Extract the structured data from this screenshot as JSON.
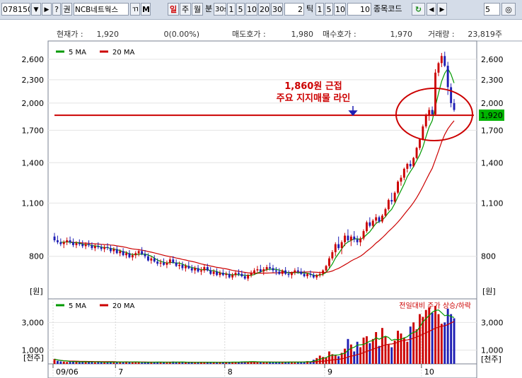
{
  "toolbar": {
    "stock_code": "078150",
    "btn_dropdown": "▼",
    "btn_next": "▶",
    "btn_help": "?",
    "btn_right": "권",
    "stock_name": "NCB네트웍스",
    "btn_mode1": "ㄲ",
    "btn_mode2": "M",
    "period_day": "일",
    "period_week": "주",
    "period_month": "월",
    "minute_label": "분",
    "minute_options": [
      "30s",
      "1",
      "5",
      "10",
      "20",
      "30"
    ],
    "minute_input": "2",
    "tick_label": "틱",
    "tick_options": [
      "1",
      "5",
      "10"
    ],
    "tick_input": "10",
    "code_label": "종목코드",
    "count_input": "5"
  },
  "info_bar": {
    "price_label": "현재가 :",
    "price_value": "1,920",
    "change_value": "0(0.00%)",
    "ask_label": "매도호가 :",
    "ask_value": "1,980",
    "bid_label": "매수호가 :",
    "bid_value": "1,970",
    "volume_label": "거래량 :",
    "volume_value": "23,819주"
  },
  "price_panel": {
    "legend": [
      "5 MA",
      "20 MA"
    ],
    "unit_label": "[원]",
    "current_price_tag": "1,920",
    "annotation_line1": "1,860원 근접",
    "annotation_line2": "주요 지지매물 라인"
  },
  "volume_panel": {
    "legend": [
      "5 MA",
      "20 MA"
    ],
    "unit_label": "[천주]",
    "right_note": "전일대비 주가 상승/하락"
  },
  "x_labels": [
    "09/06",
    "7",
    "8",
    "9",
    "10"
  ],
  "colors": {
    "up": "#cc0000",
    "down": "#1e1eb4",
    "ma5": "#009900",
    "ma20": "#cc0000",
    "support_line": "#cc0000",
    "price_tag": "#00b400"
  },
  "chart_data": [
    {
      "type": "candlestick",
      "title": "",
      "y_scale": "log",
      "y_ticks": [
        800,
        1100,
        1400,
        1700,
        2000,
        2300,
        2600
      ],
      "ylim": [
        620,
        2900
      ],
      "support_level": 1860,
      "series": [
        {
          "name": "5 MA"
        },
        {
          "name": "20 MA"
        }
      ],
      "candles": [
        [
          900,
          920,
          870,
          880
        ],
        [
          880,
          905,
          860,
          870
        ],
        [
          870,
          890,
          850,
          860
        ],
        [
          860,
          880,
          840,
          870
        ],
        [
          870,
          895,
          855,
          880
        ],
        [
          880,
          900,
          860,
          870
        ],
        [
          870,
          890,
          845,
          855
        ],
        [
          855,
          875,
          840,
          865
        ],
        [
          865,
          885,
          850,
          860
        ],
        [
          860,
          880,
          840,
          850
        ],
        [
          850,
          870,
          835,
          860
        ],
        [
          860,
          880,
          845,
          855
        ],
        [
          855,
          870,
          830,
          840
        ],
        [
          840,
          860,
          825,
          850
        ],
        [
          850,
          870,
          835,
          845
        ],
        [
          845,
          860,
          825,
          835
        ],
        [
          835,
          855,
          820,
          845
        ],
        [
          845,
          865,
          830,
          840
        ],
        [
          840,
          855,
          815,
          825
        ],
        [
          825,
          845,
          810,
          835
        ],
        [
          835,
          850,
          810,
          815
        ],
        [
          815,
          835,
          800,
          825
        ],
        [
          825,
          840,
          800,
          805
        ],
        [
          805,
          825,
          790,
          815
        ],
        [
          815,
          830,
          790,
          795
        ],
        [
          795,
          815,
          780,
          805
        ],
        [
          805,
          825,
          790,
          815
        ],
        [
          815,
          835,
          800,
          825
        ],
        [
          825,
          845,
          805,
          810
        ],
        [
          810,
          830,
          790,
          800
        ],
        [
          800,
          815,
          775,
          780
        ],
        [
          780,
          800,
          765,
          790
        ],
        [
          790,
          805,
          770,
          775
        ],
        [
          775,
          790,
          755,
          765
        ],
        [
          765,
          785,
          750,
          770
        ],
        [
          770,
          790,
          755,
          760
        ],
        [
          760,
          780,
          745,
          770
        ],
        [
          770,
          795,
          760,
          785
        ],
        [
          785,
          800,
          765,
          770
        ],
        [
          770,
          785,
          750,
          755
        ],
        [
          755,
          775,
          740,
          760
        ],
        [
          760,
          775,
          735,
          745
        ],
        [
          745,
          765,
          730,
          755
        ],
        [
          755,
          775,
          740,
          745
        ],
        [
          745,
          760,
          725,
          735
        ],
        [
          735,
          755,
          720,
          745
        ],
        [
          745,
          760,
          725,
          730
        ],
        [
          730,
          750,
          715,
          735
        ],
        [
          735,
          760,
          725,
          750
        ],
        [
          750,
          765,
          730,
          735
        ],
        [
          735,
          750,
          715,
          720
        ],
        [
          720,
          740,
          710,
          730
        ],
        [
          730,
          745,
          710,
          715
        ],
        [
          715,
          735,
          705,
          725
        ],
        [
          725,
          740,
          710,
          715
        ],
        [
          715,
          730,
          700,
          720
        ],
        [
          720,
          735,
          700,
          705
        ],
        [
          705,
          725,
          695,
          715
        ],
        [
          715,
          735,
          705,
          725
        ],
        [
          725,
          740,
          710,
          720
        ],
        [
          720,
          735,
          705,
          710
        ],
        [
          710,
          725,
          695,
          700
        ],
        [
          700,
          720,
          690,
          715
        ],
        [
          715,
          735,
          705,
          725
        ],
        [
          725,
          745,
          715,
          735
        ],
        [
          735,
          755,
          720,
          740
        ],
        [
          740,
          760,
          725,
          730
        ],
        [
          730,
          750,
          715,
          740
        ],
        [
          740,
          760,
          730,
          750
        ],
        [
          750,
          770,
          735,
          745
        ],
        [
          745,
          760,
          725,
          735
        ],
        [
          735,
          750,
          715,
          730
        ],
        [
          730,
          745,
          715,
          720
        ],
        [
          720,
          740,
          710,
          735
        ],
        [
          735,
          750,
          715,
          720
        ],
        [
          720,
          735,
          705,
          715
        ],
        [
          715,
          730,
          700,
          725
        ],
        [
          725,
          745,
          715,
          735
        ],
        [
          735,
          750,
          720,
          730
        ],
        [
          730,
          745,
          715,
          720
        ],
        [
          720,
          735,
          705,
          710
        ],
        [
          710,
          725,
          700,
          720
        ],
        [
          720,
          735,
          705,
          715
        ],
        [
          715,
          725,
          700,
          705
        ],
        [
          705,
          720,
          695,
          715
        ],
        [
          715,
          730,
          705,
          720
        ],
        [
          720,
          740,
          710,
          735
        ],
        [
          735,
          760,
          725,
          755
        ],
        [
          755,
          800,
          745,
          790
        ],
        [
          790,
          830,
          780,
          820
        ],
        [
          820,
          870,
          800,
          860
        ],
        [
          860,
          900,
          830,
          840
        ],
        [
          840,
          880,
          810,
          870
        ],
        [
          870,
          920,
          850,
          905
        ],
        [
          905,
          940,
          870,
          880
        ],
        [
          880,
          910,
          850,
          900
        ],
        [
          900,
          930,
          870,
          885
        ],
        [
          885,
          905,
          855,
          870
        ],
        [
          870,
          900,
          850,
          890
        ],
        [
          890,
          940,
          880,
          930
        ],
        [
          930,
          990,
          920,
          980
        ],
        [
          980,
          1010,
          950,
          960
        ],
        [
          960,
          1000,
          945,
          990
        ],
        [
          990,
          1030,
          970,
          1010
        ],
        [
          1010,
          1020,
          975,
          985
        ],
        [
          985,
          1030,
          975,
          1020
        ],
        [
          1020,
          1070,
          1010,
          1060
        ],
        [
          1060,
          1130,
          1050,
          1120
        ],
        [
          1120,
          1170,
          1090,
          1110
        ],
        [
          1110,
          1180,
          1100,
          1170
        ],
        [
          1170,
          1260,
          1160,
          1250
        ],
        [
          1250,
          1300,
          1220,
          1280
        ],
        [
          1280,
          1360,
          1260,
          1350
        ],
        [
          1350,
          1400,
          1320,
          1390
        ],
        [
          1390,
          1420,
          1350,
          1370
        ],
        [
          1370,
          1450,
          1360,
          1440
        ],
        [
          1440,
          1540,
          1430,
          1530
        ],
        [
          1530,
          1620,
          1510,
          1610
        ],
        [
          1610,
          1760,
          1600,
          1740
        ],
        [
          1740,
          1880,
          1720,
          1860
        ],
        [
          1860,
          1950,
          1800,
          1920
        ],
        [
          1920,
          1960,
          1850,
          1870
        ],
        [
          1870,
          2450,
          1860,
          2400
        ],
        [
          2400,
          2560,
          2350,
          2540
        ],
        [
          2540,
          2700,
          2480,
          2650
        ],
        [
          2650,
          2720,
          2480,
          2500
        ],
        [
          2500,
          2560,
          2100,
          2200
        ],
        [
          2200,
          2250,
          1950,
          2000
        ],
        [
          2000,
          2050,
          1900,
          1920
        ]
      ]
    },
    {
      "type": "bar",
      "title": "",
      "ylabel": "[천주]",
      "y_ticks": [
        1000,
        3000
      ],
      "ylim": [
        0,
        4500
      ],
      "series": [
        {
          "name": "5 MA"
        },
        {
          "name": "20 MA"
        }
      ],
      "values": [
        350,
        220,
        180,
        160,
        140,
        150,
        180,
        160,
        120,
        140,
        170,
        130,
        160,
        110,
        150,
        120,
        100,
        130,
        160,
        140,
        120,
        110,
        150,
        180,
        130,
        120,
        140,
        100,
        90,
        120,
        140,
        110,
        150,
        130,
        100,
        120,
        90,
        140,
        170,
        130,
        110,
        120,
        100,
        130,
        110,
        90,
        120,
        150,
        110,
        100,
        130,
        120,
        90,
        110,
        130,
        140,
        120,
        150,
        110,
        130,
        170,
        180,
        150,
        160,
        120,
        140,
        110,
        130,
        150,
        120,
        100,
        110,
        140,
        130,
        120,
        150,
        110,
        130,
        120,
        140,
        160,
        200,
        180,
        300,
        420,
        600,
        500,
        450,
        900,
        700,
        650,
        550,
        800,
        1100,
        1800,
        1400,
        900,
        1600,
        1200,
        1900,
        2000,
        1500,
        1800,
        2300,
        1300,
        2600,
        2000,
        1400,
        1200,
        1700,
        2400,
        2200,
        1900,
        1600,
        2700,
        3000,
        2500,
        3600,
        3400,
        3900,
        4100,
        3700,
        4200,
        3600,
        2900,
        3000,
        4000,
        3600,
        3300
      ]
    }
  ]
}
